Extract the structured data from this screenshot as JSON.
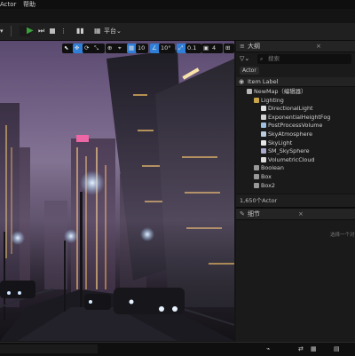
{
  "menu": {
    "actor": "Actor",
    "help": "帮助"
  },
  "toolbar": {
    "platform": "平台"
  },
  "viewport_toolbar": {
    "grid_value": "10",
    "rotate_value": "10°",
    "scale_value": "0.1",
    "camera_value": "4"
  },
  "outliner": {
    "tab_title": "大纲",
    "search_placeholder": "搜索",
    "column_label": "Item Label",
    "filter_label": "Actor",
    "items": [
      {
        "label": "NewMap（编辑器）",
        "indent": 1,
        "icon": "map-icon"
      },
      {
        "label": "Lighting",
        "indent": 2,
        "icon": "folder-icon"
      },
      {
        "label": "DirectionalLight",
        "indent": 3,
        "icon": "light-icon"
      },
      {
        "label": "ExponentialHeightFog",
        "indent": 3,
        "icon": "fog-icon"
      },
      {
        "label": "PostProcessVolume",
        "indent": 3,
        "icon": "volume-icon"
      },
      {
        "label": "SkyAtmosphere",
        "indent": 3,
        "icon": "atmosphere-icon"
      },
      {
        "label": "SkyLight",
        "indent": 3,
        "icon": "skylight-icon"
      },
      {
        "label": "SM_SkySphere",
        "indent": 3,
        "icon": "mesh-icon"
      },
      {
        "label": "VolumetricCloud",
        "indent": 3,
        "icon": "cloud-icon"
      },
      {
        "label": "Boolean",
        "indent": 2,
        "icon": "actor-icon"
      },
      {
        "label": "Box",
        "indent": 2,
        "icon": "actor-icon"
      },
      {
        "label": "Box2",
        "indent": 2,
        "icon": "actor-icon"
      }
    ],
    "actor_count": "1,650个Actor"
  },
  "details": {
    "tab_title": "细节",
    "hint": "选择一个对象"
  },
  "colors": {
    "accent": "#2f7fd8",
    "play": "#3aa23a",
    "folder": "#c9a548"
  }
}
